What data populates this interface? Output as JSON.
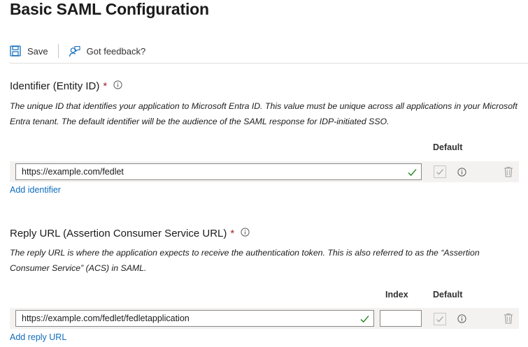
{
  "page": {
    "title": "Basic SAML Configuration"
  },
  "toolbar": {
    "save_label": "Save",
    "feedback_label": "Got feedback?"
  },
  "identifier": {
    "title": "Identifier (Entity ID)",
    "required_mark": "*",
    "description": "The unique ID that identifies your application to Microsoft Entra ID. This value must be unique across all applications in your Microsoft Entra tenant. The default identifier will be the audience of the SAML response for IDP-initiated SSO.",
    "default_header": "Default",
    "value": "https://example.com/fedlet",
    "add_link": "Add identifier"
  },
  "reply_url": {
    "title": "Reply URL (Assertion Consumer Service URL)",
    "required_mark": "*",
    "description": "The reply URL is where the application expects to receive the authentication token. This is also referred to as the “Assertion Consumer Service” (ACS) in SAML.",
    "index_header": "Index",
    "default_header": "Default",
    "value": "https://example.com/fedlet/fedletapplication",
    "index_value": "",
    "add_link": "Add reply URL"
  },
  "colors": {
    "link": "#0f6cbd",
    "required": "#a4262c",
    "valid": "#107c10"
  },
  "icons": {
    "save": "save-icon",
    "feedback": "feedback-icon",
    "info": "info-icon",
    "valid": "checkmark-icon",
    "delete": "trash-icon"
  }
}
